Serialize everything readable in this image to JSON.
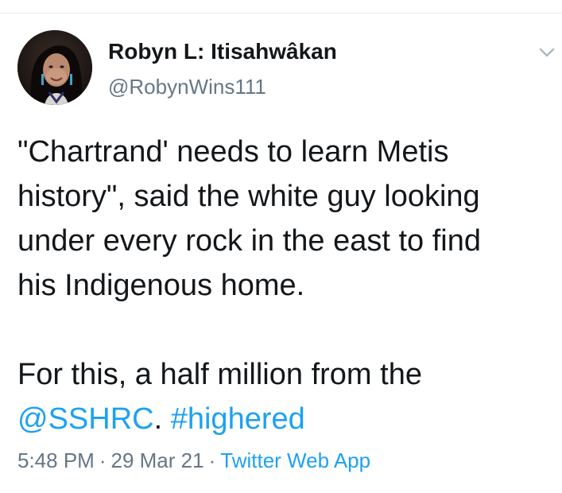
{
  "tweet": {
    "display_name": "Robyn L: Itisahwâkan",
    "handle": "@RobynWins111",
    "avatar_icon": "user-avatar",
    "menu_icon": "chevron-down-icon",
    "lines": [
      "\"Chartrand' needs to learn Metis",
      "history\", said the white guy looking",
      "under every rock in the east to find",
      "his Indigenous home."
    ],
    "line5_prefix": "For this, a half million from the",
    "mention": "@SSHRC",
    "mention_suffix": ".",
    "hashtag": "#highered",
    "time": "5:48 PM",
    "separator": "·",
    "date": "29 Mar 21",
    "source": "Twitter Web App"
  },
  "colors": {
    "text": "#14171a",
    "secondary": "#657786",
    "link": "#1da1f2",
    "divider": "#e6ecf0"
  }
}
